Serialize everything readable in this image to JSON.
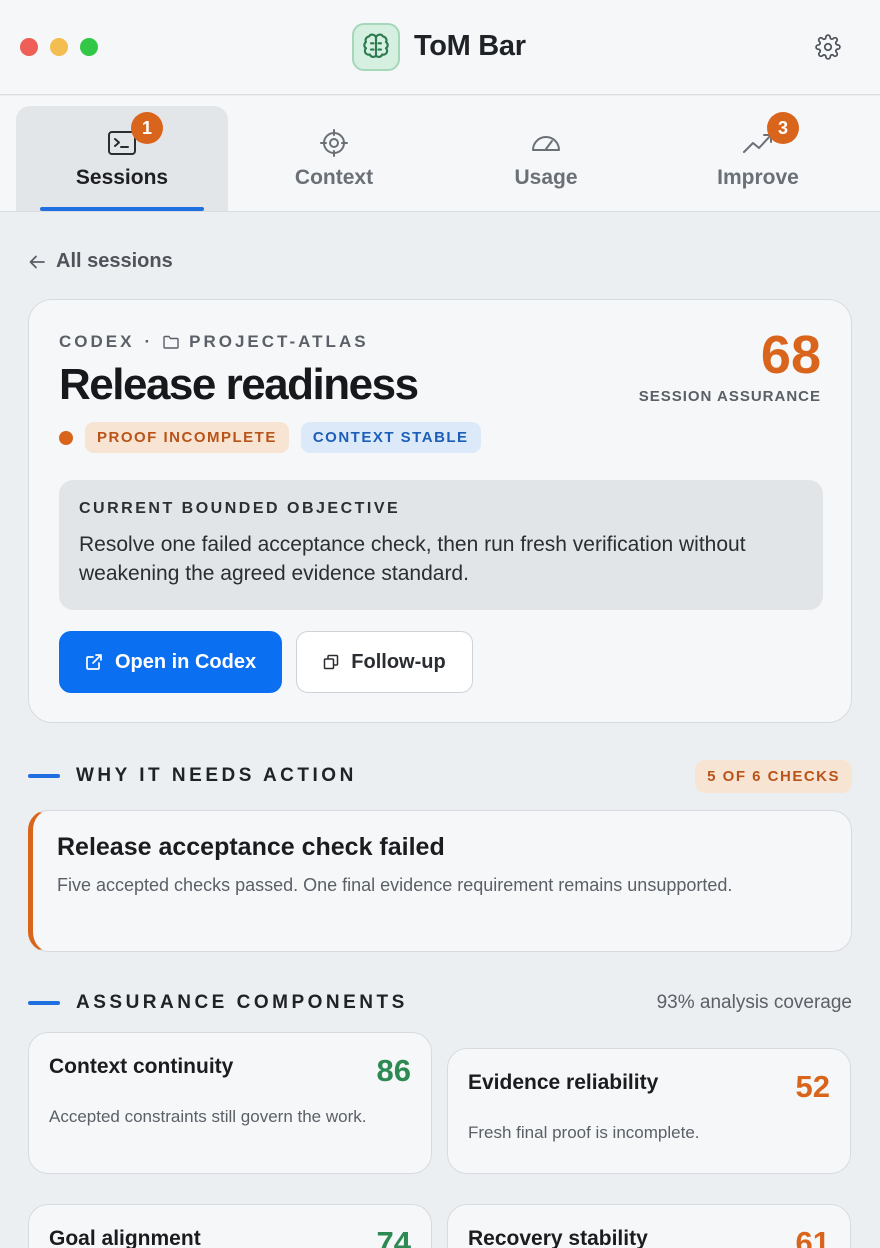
{
  "app": {
    "title": "ToM Bar"
  },
  "tabs": [
    {
      "label": "Sessions",
      "icon": "terminal-icon",
      "badge": "1",
      "active": true
    },
    {
      "label": "Context",
      "icon": "target-icon",
      "badge": null,
      "active": false
    },
    {
      "label": "Usage",
      "icon": "gauge-icon",
      "badge": null,
      "active": false
    },
    {
      "label": "Improve",
      "icon": "trend-up-icon",
      "badge": "3",
      "active": false
    }
  ],
  "back": {
    "label": "All sessions"
  },
  "session": {
    "agent": "CODEX",
    "separator": "·",
    "project": "PROJECT-ATLAS",
    "title": "Release readiness",
    "score": "68",
    "score_label": "SESSION ASSURANCE",
    "status_pills": [
      "PROOF INCOMPLETE",
      "CONTEXT STABLE"
    ],
    "objective_label": "CURRENT BOUNDED OBJECTIVE",
    "objective_text": "Resolve one failed acceptance check, then run fresh verification without weakening the agreed evidence standard.",
    "primary_button": "Open in Codex",
    "secondary_button": "Follow-up"
  },
  "why": {
    "title": "WHY IT NEEDS ACTION",
    "count": "5 OF 6 CHECKS",
    "alert_title": "Release acceptance check failed",
    "alert_text": "Five accepted checks passed. One final evidence requirement remains unsupported."
  },
  "components": {
    "title": "ASSURANCE COMPONENTS",
    "coverage": "93% analysis coverage",
    "items": [
      {
        "title": "Context continuity",
        "score": "86",
        "text": "Accepted constraints still govern the work.",
        "tone": "green"
      },
      {
        "title": "Evidence reliability",
        "score": "52",
        "text": "Fresh final proof is incomplete.",
        "tone": "orange"
      },
      {
        "title": "Goal alignment",
        "score": "74",
        "text": "",
        "tone": "green"
      },
      {
        "title": "Recovery stability",
        "score": "61",
        "text": "",
        "tone": "orange"
      }
    ]
  },
  "colors": {
    "accent": "#1f6fe0",
    "warning": "#d9651c",
    "good": "#2c8a52",
    "primary_button": "#0a6ff0"
  }
}
